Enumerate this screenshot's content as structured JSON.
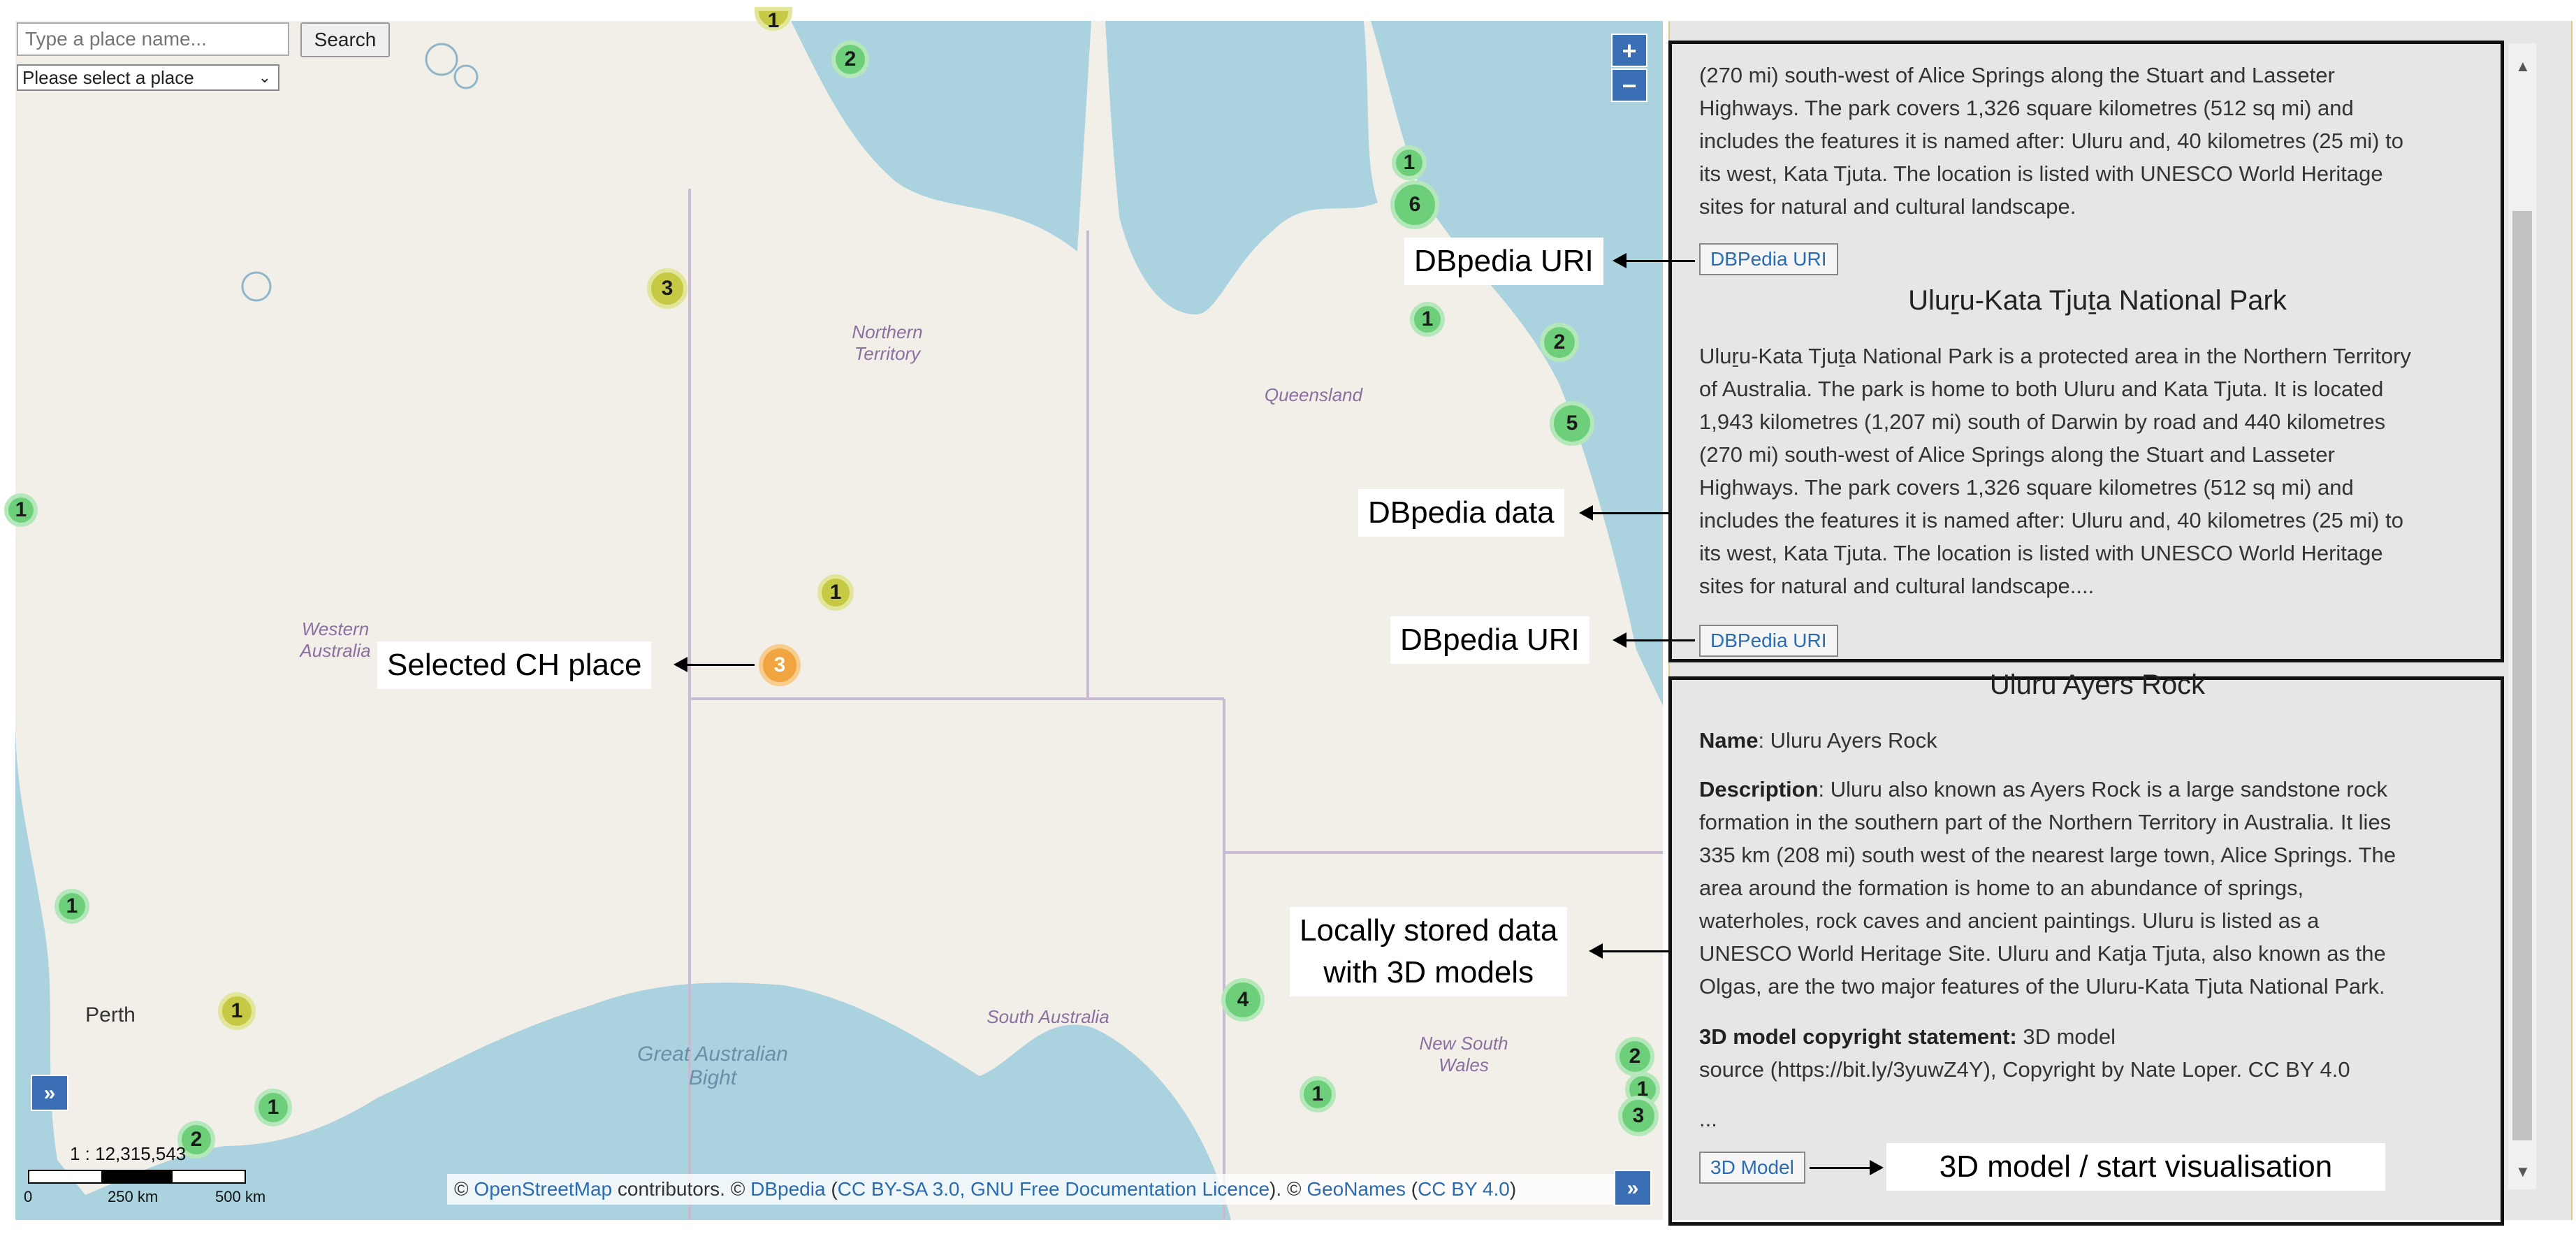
{
  "search": {
    "placeholder": "Type a place name...",
    "button": "Search"
  },
  "select": {
    "value": "Please select a place"
  },
  "zoom": {
    "in": "+",
    "out": "−"
  },
  "map_labels": {
    "northern_territory": "Northern\nTerritory",
    "queensland": "Queensland",
    "western_australia": "Western\nAustralia",
    "south_australia": "South Australia",
    "new_south_wales": "New South\nWales",
    "great_australian_bight": "Great Australian\nBight",
    "perth": "Perth"
  },
  "clusters": [
    "2",
    "1",
    "6",
    "3",
    "1",
    "2",
    "5",
    "1",
    "1",
    "3",
    "1",
    "4",
    "1",
    "1",
    "1",
    "2",
    "2",
    "1",
    "3",
    "1"
  ],
  "scale": {
    "ratio": "1 : 12,315,543",
    "t0": "0",
    "t1": "250 km",
    "t2": "500 km"
  },
  "attribution": {
    "p1": "© ",
    "osm": "OpenStreetMap",
    "p2": " contributors. © ",
    "dbpedia": "DBpedia",
    "p3": " (",
    "license": "CC BY-SA 3.0, GNU Free Documentation Licence",
    "p4": "). © ",
    "geonames": "GeoNames",
    "p5": " (",
    "ccby": "CC BY 4.0",
    "p6": ")"
  },
  "expand_icon": "»",
  "callouts": {
    "dbpedia_uri": "DBpedia URI",
    "dbpedia_data": "DBpedia data",
    "selected_place": "Selected CH place",
    "local_data": "Locally stored data\nwith 3D models",
    "model_vis": "3D model / start visualisation"
  },
  "panel": {
    "top_lines": [
      "(270 mi) south-west of Alice Springs along the Stuart and Lasseter",
      "Highways. The park covers 1,326 square kilometres (512 sq mi) and",
      "includes the features it is named after: Uluru and, 40 kilometres (25 mi) to",
      "its west, Kata Tjuta. The location is listed with UNESCO World Heritage",
      "sites for natural and cultural landscape."
    ],
    "uri_button": "DBPedia URI",
    "park_title": "Uluṟu-Kata Tjuṯa National Park",
    "park_lines": [
      "Uluṟu-Kata Tjuṯa National Park is a protected area in the Northern Territory",
      "of Australia. The park is home to both Uluru and Kata Tjuta. It is located",
      "1,943 kilometres (1,207 mi) south of Darwin by road and 440 kilometres",
      "(270 mi) south-west of Alice Springs along the Stuart and Lasseter",
      "Highways. The park covers 1,326 square kilometres (512 sq mi) and",
      "includes the features it is named after: Uluru and, 40 kilometres (25 mi) to",
      "its west, Kata Tjuta. The location is listed with UNESCO World Heritage",
      "sites for natural and cultural landscape...."
    ],
    "local_title": "Uluru Ayers Rock",
    "name_label": "Name",
    "name_value": ": Uluru Ayers Rock",
    "desc_label": "Description",
    "desc_lines": [
      ": Uluru also known as Ayers Rock is a large sandstone rock",
      "formation in the southern part of the Northern Territory in Australia. It lies",
      "335 km (208 mi) south west of the nearest large town, Alice Springs. The",
      "area around the formation is home to an abundance of springs,",
      "waterholes, rock caves and ancient paintings. Uluru is listed as a",
      "UNESCO World Heritage Site. Uluru and Katja Tjuta, also known as the",
      "Olgas, are the two major features of the Uluru-Kata Tjuta National Park."
    ],
    "copyright_label": "3D model copyright statement:",
    "copyright_lines": [
      " 3D model",
      "source (https://bit.ly/3yuwZ4Y), Copyright by Nate Loper. CC BY 4.0"
    ],
    "ellipsis": "...",
    "model_button": "3D Model"
  }
}
